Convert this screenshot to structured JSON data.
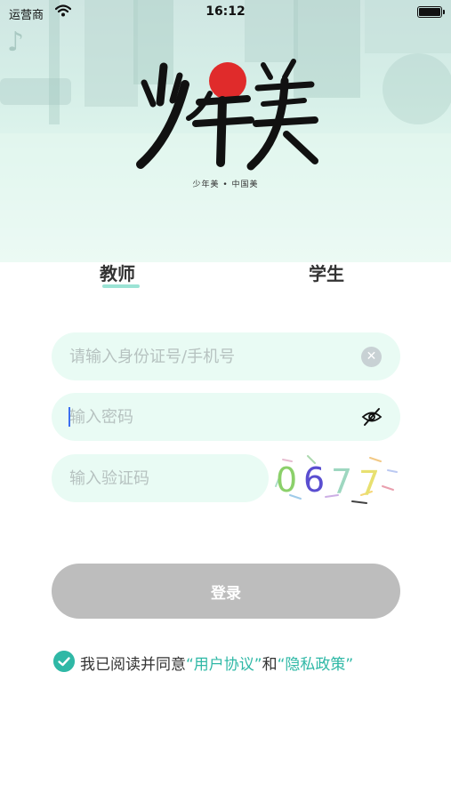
{
  "status_bar": {
    "carrier": "运营商",
    "time": "16:12",
    "battery_level": 1.0
  },
  "hero": {
    "logo_text": "少年美",
    "tagline": "少年美 • 中国美"
  },
  "tabs": [
    {
      "label": "教师",
      "active": true
    },
    {
      "label": "学生",
      "active": false
    }
  ],
  "form": {
    "account": {
      "placeholder": "请输入身份证号/手机号",
      "value": ""
    },
    "password": {
      "placeholder": "输入密码",
      "value": ""
    },
    "captcha_input": {
      "placeholder": "输入验证码",
      "value": ""
    },
    "captcha_code": "0677"
  },
  "login": {
    "label": "登录"
  },
  "agreement": {
    "checked": true,
    "prefix": "我已阅读并同意",
    "user_agreement": "“用户协议”",
    "joiner": "和",
    "privacy_policy": "“隐私政策”"
  },
  "colors": {
    "accent": "#2fb8a6",
    "field_bg": "#e9fbf4",
    "login_disabled": "#bdbdbd",
    "logo_red": "#e02b2b"
  }
}
